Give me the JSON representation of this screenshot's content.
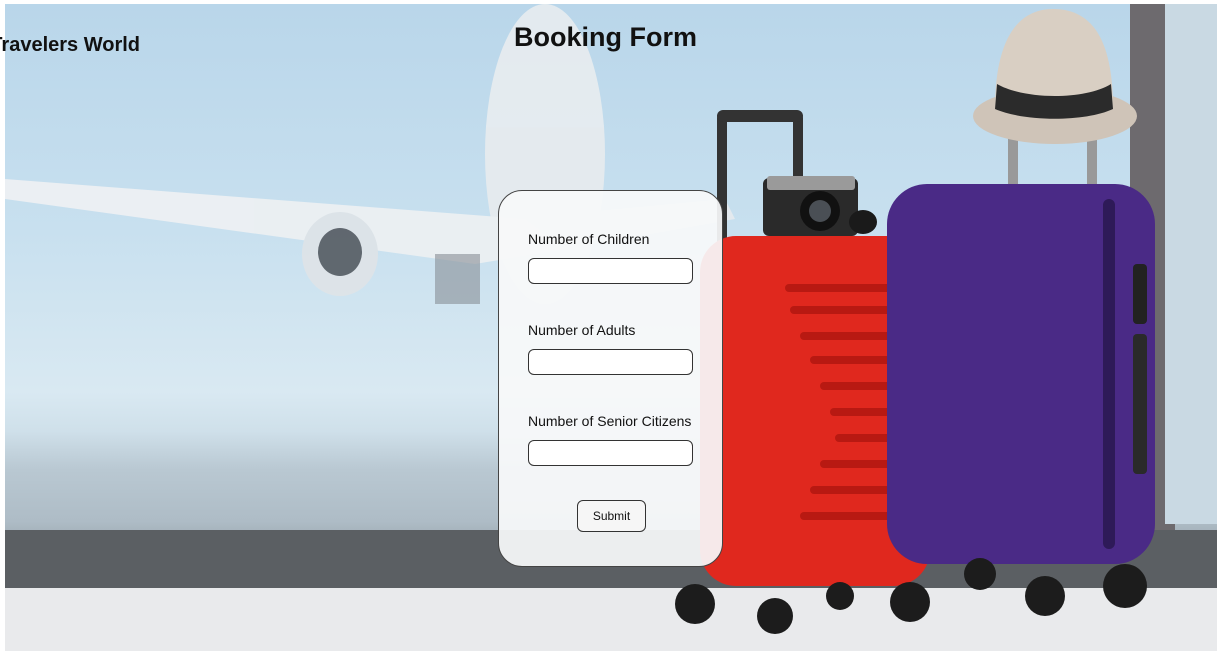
{
  "header": {
    "brand": "Travelers World",
    "title": "Booking Form"
  },
  "form": {
    "fields": [
      {
        "label": "Number of Children",
        "value": ""
      },
      {
        "label": "Number of Adults",
        "value": ""
      },
      {
        "label": "Number of Senior Citizens",
        "value": ""
      }
    ],
    "submit_label": "Submit"
  },
  "background": {
    "description_icons": [
      "airplane-icon",
      "red-suitcase-icon",
      "purple-suitcase-icon",
      "hat-icon",
      "camera-icon"
    ],
    "colors": {
      "red_suitcase": "#e0281e",
      "purple_suitcase": "#4a2a86",
      "sky": "#c8e0ef"
    }
  }
}
